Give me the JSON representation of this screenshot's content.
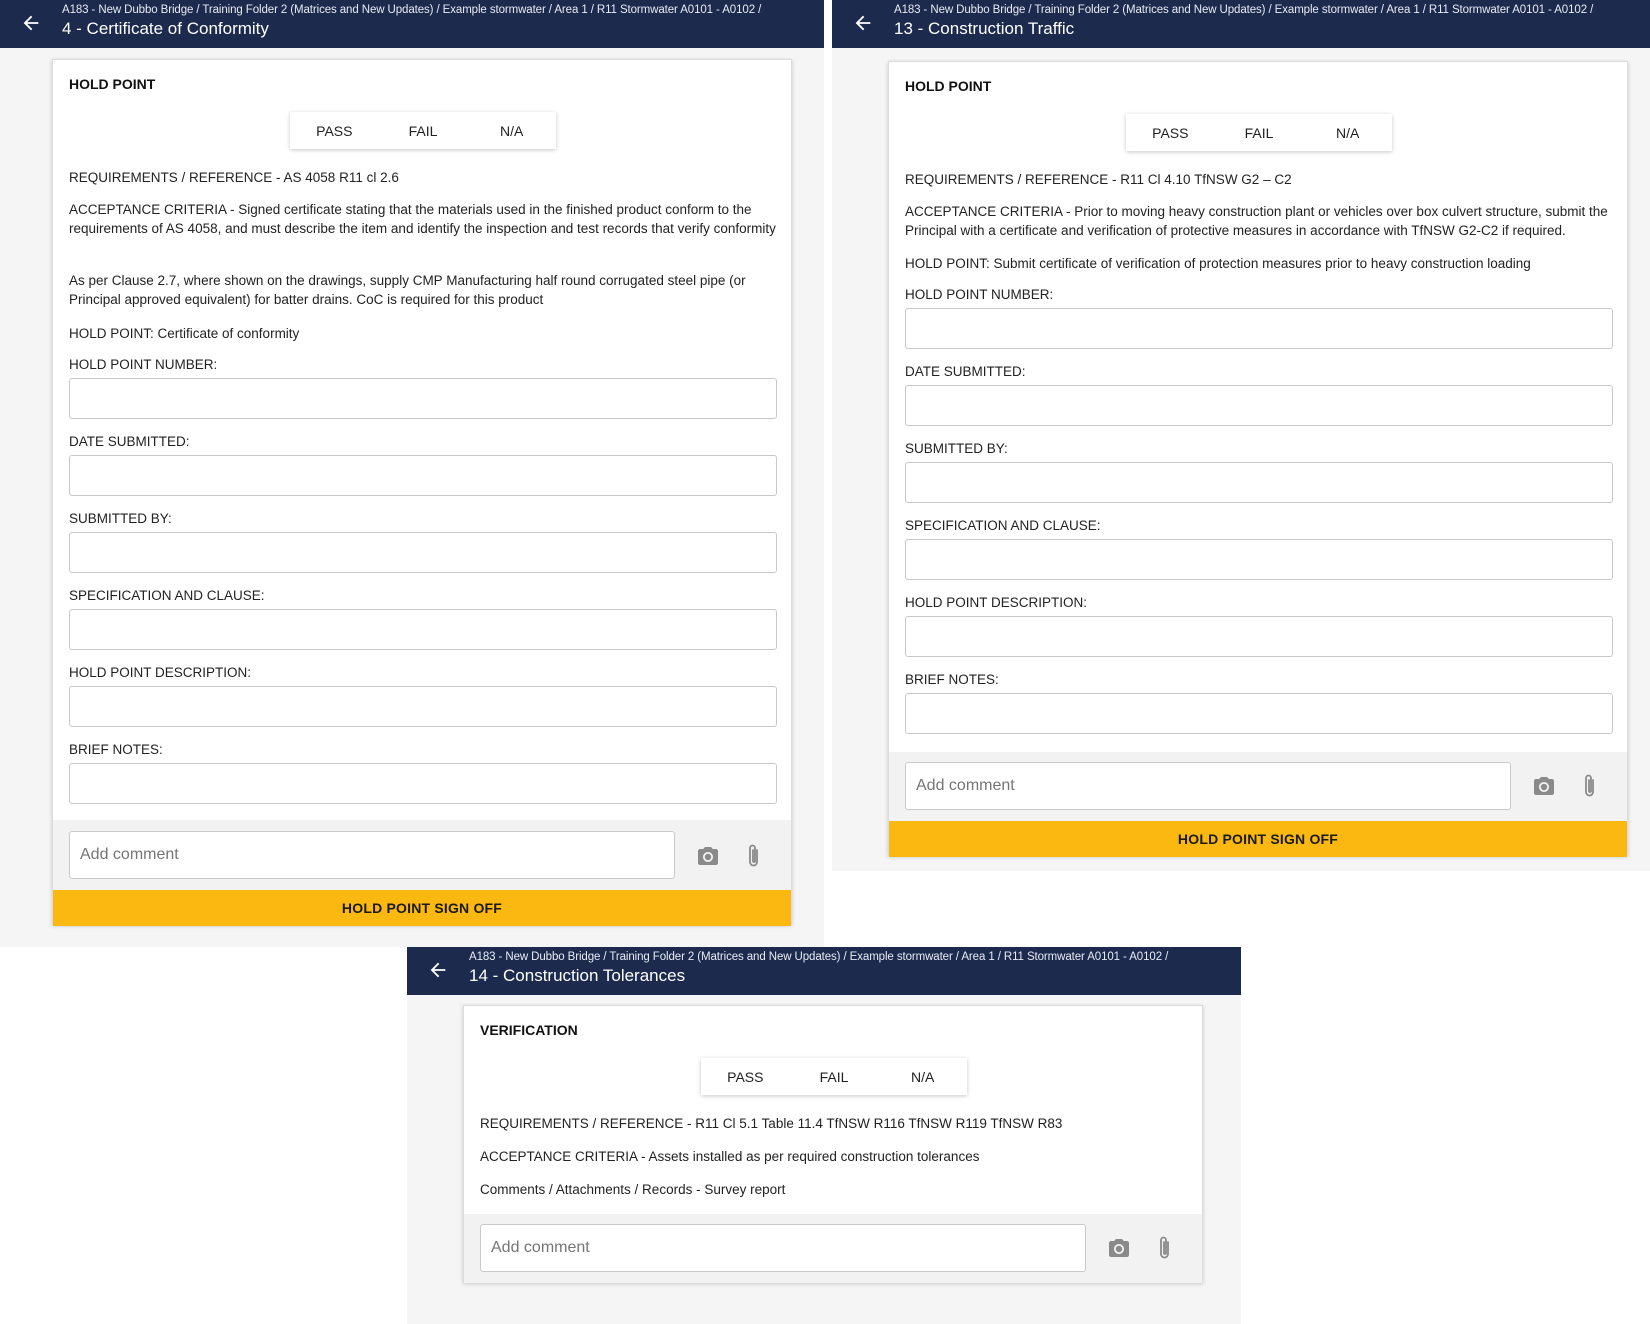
{
  "icons": {
    "back": "arrow-left-icon",
    "camera": "camera-icon",
    "attach": "paperclip-icon"
  },
  "colors": {
    "appbar": "#1c2a4e",
    "signoff": "#fbb811",
    "background": "#f5f5f5"
  },
  "panels": [
    {
      "breadcrumb": "A183 - New Dubbo Bridge / Training Folder 2 (Matrices and New Updates) / Example stormwater / Area 1 / R11 Stormwater A0101 - A0102 /",
      "title": "4 - Certificate of Conformity",
      "section": "HOLD POINT",
      "options": {
        "pass": "PASS",
        "fail": "FAIL",
        "na": "N/A"
      },
      "texts": [
        "REQUIREMENTS / REFERENCE - AS 4058 R11 cl 2.6",
        "ACCEPTANCE CRITERIA - Signed certificate stating that the materials used in the finished product conform to the requirements of AS 4058, and must describe the item and identify the inspection and test records that verify conformity",
        "As per Clause 2.7, where shown on the drawings, supply CMP Manufacturing half round corrugated steel pipe (or Principal approved equivalent) for batter drains. CoC is required for this product",
        "HOLD POINT: Certificate of conformity"
      ],
      "fields": [
        "HOLD POINT NUMBER:",
        "DATE SUBMITTED:",
        "SUBMITTED BY:",
        "SPECIFICATION AND CLAUSE:",
        "HOLD POINT DESCRIPTION:",
        "BRIEF NOTES:"
      ],
      "comment_placeholder": "Add comment",
      "signoff": "HOLD POINT SIGN OFF"
    },
    {
      "breadcrumb": "A183 - New Dubbo Bridge / Training Folder 2 (Matrices and New Updates) / Example stormwater / Area 1 / R11 Stormwater A0101 - A0102 /",
      "title": "13 - Construction Traffic",
      "section": "HOLD POINT",
      "options": {
        "pass": "PASS",
        "fail": "FAIL",
        "na": "N/A"
      },
      "texts": [
        "REQUIREMENTS / REFERENCE - R11 Cl 4.10 TfNSW G2 – C2",
        "ACCEPTANCE CRITERIA - Prior to moving heavy construction plant or vehicles over box culvert structure, submit the Principal with a certificate and verification of protective measures in accordance with TfNSW G2-C2 if required.",
        "HOLD POINT: Submit certificate of verification of protection measures prior to heavy construction loading"
      ],
      "fields": [
        "HOLD POINT NUMBER:",
        "DATE SUBMITTED:",
        "SUBMITTED BY:",
        "SPECIFICATION AND CLAUSE:",
        "HOLD POINT DESCRIPTION:",
        "BRIEF NOTES:"
      ],
      "comment_placeholder": "Add comment",
      "signoff": "HOLD POINT SIGN OFF"
    },
    {
      "breadcrumb": "A183 - New Dubbo Bridge / Training Folder 2 (Matrices and New Updates) / Example stormwater / Area 1 / R11 Stormwater A0101 - A0102 /",
      "title": "14 - Construction Tolerances",
      "section": "VERIFICATION",
      "options": {
        "pass": "PASS",
        "fail": "FAIL",
        "na": "N/A"
      },
      "texts": [
        "REQUIREMENTS / REFERENCE - R11 Cl 5.1 Table 11.4 TfNSW R116 TfNSW R119 TfNSW R83",
        "ACCEPTANCE CRITERIA - Assets installed as per required construction tolerances",
        "Comments / Attachments / Records - Survey report"
      ],
      "comment_placeholder": "Add comment"
    }
  ]
}
